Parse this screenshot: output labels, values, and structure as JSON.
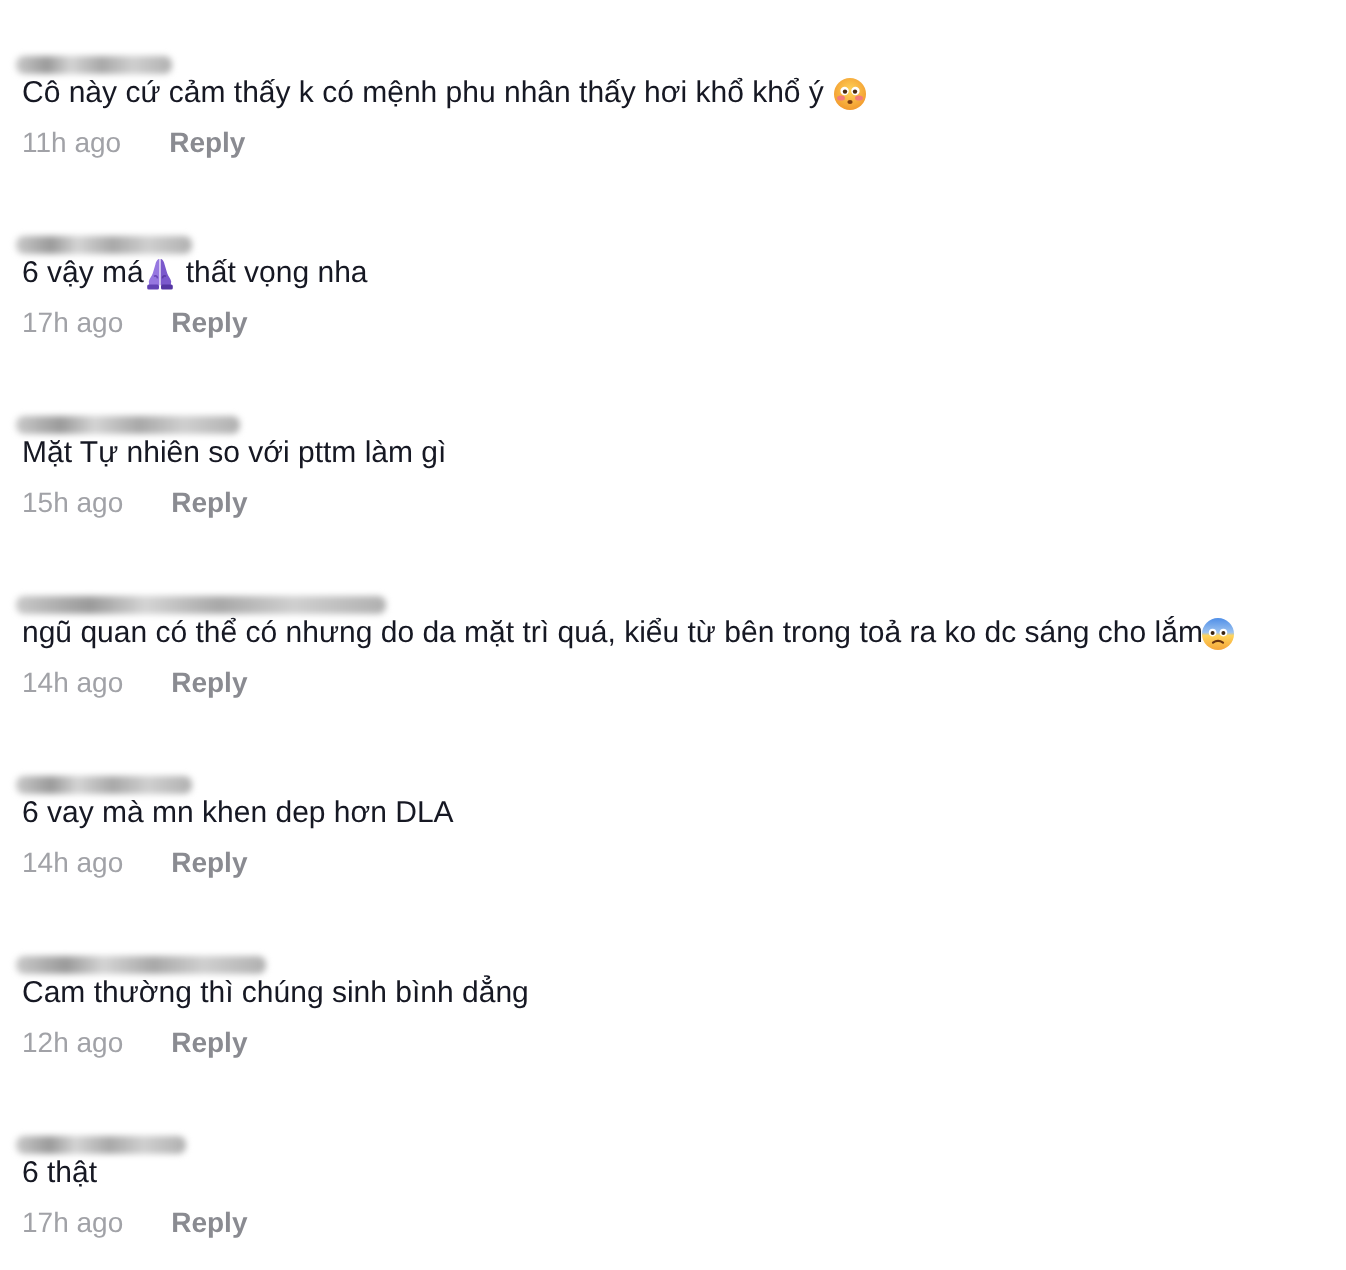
{
  "comments": [
    {
      "body": [
        {
          "kind": "text",
          "text": "Cô này cứ cảm thấy k có mệnh phu nhân thấy hơi khổ khổ ý"
        },
        {
          "kind": "face"
        }
      ],
      "time": "11h ago",
      "reply": "Reply"
    },
    {
      "body": [
        {
          "kind": "text",
          "text": "6 vậy má"
        },
        {
          "kind": "hands"
        },
        {
          "kind": "text",
          "text": "thất vọng nha"
        }
      ],
      "time": "17h ago",
      "reply": "Reply"
    },
    {
      "body": [
        {
          "kind": "text",
          "text": "Mặt Tự nhiên so với pttm làm gì"
        }
      ],
      "time": "15h ago",
      "reply": "Reply"
    },
    {
      "body": [
        {
          "kind": "text",
          "text": "ngũ quan có thể có nhưng do da mặt trì quá, kiểu từ bên trong toả ra ko dc sáng cho lắm"
        },
        {
          "kind": "sweat"
        }
      ],
      "time": "14h ago",
      "reply": "Reply"
    },
    {
      "body": [
        {
          "kind": "text",
          "text": "6 vay mà mn khen dep hơn DLA"
        }
      ],
      "time": "14h ago",
      "reply": "Reply"
    },
    {
      "body": [
        {
          "kind": "text",
          "text": "Cam thường thì chúng sinh bình dẳng"
        }
      ],
      "time": "12h ago",
      "reply": "Reply"
    },
    {
      "body": [
        {
          "kind": "text",
          "text": "6 thật"
        }
      ],
      "time": "17h ago",
      "reply": "Reply"
    }
  ]
}
